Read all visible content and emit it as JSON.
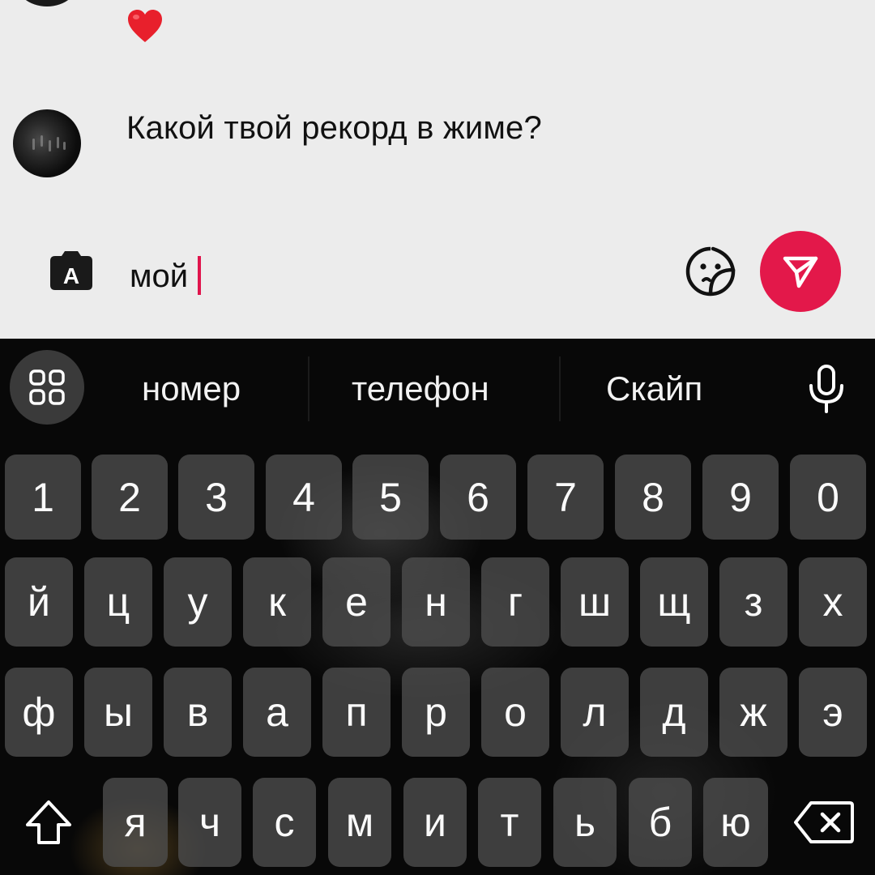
{
  "chat": {
    "reaction": "❤️",
    "message": "Какой твой рекорд в жиме?"
  },
  "composer": {
    "camera_letter": "A",
    "input_value": "мой"
  },
  "keyboard": {
    "suggestions": [
      "номер",
      "телефон",
      "Скайп"
    ],
    "row_numbers": [
      "1",
      "2",
      "3",
      "4",
      "5",
      "6",
      "7",
      "8",
      "9",
      "0"
    ],
    "row_1": [
      "й",
      "ц",
      "у",
      "к",
      "е",
      "н",
      "г",
      "ш",
      "щ",
      "з",
      "х"
    ],
    "row_2": [
      "ф",
      "ы",
      "в",
      "а",
      "п",
      "р",
      "о",
      "л",
      "д",
      "ж",
      "э"
    ],
    "row_3": [
      "я",
      "ч",
      "с",
      "м",
      "и",
      "т",
      "ь",
      "б",
      "ю"
    ]
  },
  "colors": {
    "accent": "#e3184a",
    "caret": "#e0144c",
    "background": "#ececec",
    "keyboard_bg": "#080808"
  },
  "icons": {
    "camera": "camera-icon",
    "sticker": "sticker-icon",
    "send": "send-icon",
    "apps": "apps-grid-icon",
    "mic": "microphone-icon",
    "shift": "shift-icon",
    "backspace": "backspace-icon"
  }
}
